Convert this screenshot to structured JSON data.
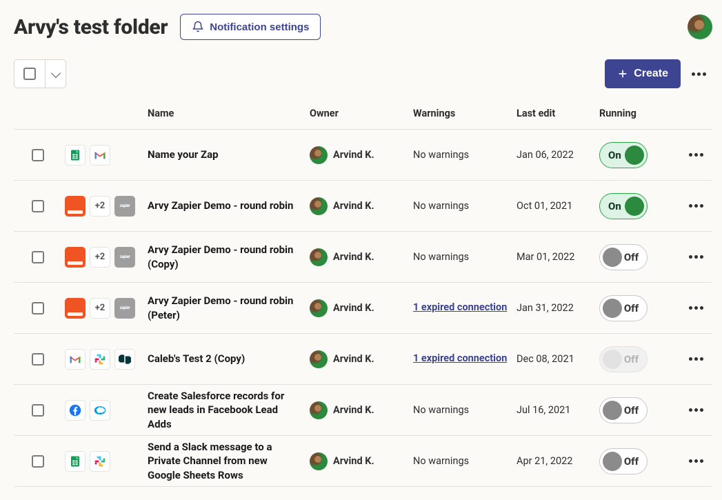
{
  "header": {
    "title": "Arvy's test folder",
    "notification_btn": "Notification settings"
  },
  "toolbar": {
    "create_label": "Create"
  },
  "columns": {
    "name": "Name",
    "owner": "Owner",
    "warnings": "Warnings",
    "last_edit": "Last edit",
    "running": "Running"
  },
  "toggle_labels": {
    "on": "On",
    "off": "Off"
  },
  "rows": [
    {
      "apps": [
        {
          "type": "sheets"
        },
        {
          "type": "gmail"
        }
      ],
      "name": "Name your Zap",
      "owner": "Arvind K.",
      "warning_text": "No warnings",
      "warning_link": null,
      "last_edit": "Jan 06, 2022",
      "running": "on"
    },
    {
      "apps": [
        {
          "type": "orange"
        },
        {
          "type": "more",
          "label": "+2"
        },
        {
          "type": "gray",
          "label": "zapier"
        }
      ],
      "name": "Arvy Zapier Demo - round robin",
      "owner": "Arvind K.",
      "warning_text": "No warnings",
      "warning_link": null,
      "last_edit": "Oct 01, 2021",
      "running": "on"
    },
    {
      "apps": [
        {
          "type": "orange"
        },
        {
          "type": "more",
          "label": "+2"
        },
        {
          "type": "gray",
          "label": "zapier"
        }
      ],
      "name": "Arvy Zapier Demo - round robin (Copy)",
      "owner": "Arvind K.",
      "warning_text": "No warnings",
      "warning_link": null,
      "last_edit": "Mar 01, 2022",
      "running": "off"
    },
    {
      "apps": [
        {
          "type": "orange"
        },
        {
          "type": "more",
          "label": "+2"
        },
        {
          "type": "gray",
          "label": "zapier"
        }
      ],
      "name": "Arvy Zapier Demo - round robin (Peter)",
      "owner": "Arvind K.",
      "warning_text": null,
      "warning_link": "1 expired connection",
      "last_edit": "Jan 31, 2022",
      "running": "off"
    },
    {
      "apps": [
        {
          "type": "gmail"
        },
        {
          "type": "slack"
        },
        {
          "type": "zendesk"
        }
      ],
      "name": "Caleb's Test 2 (Copy)",
      "owner": "Arvind K.",
      "warning_text": null,
      "warning_link": "1 expired connection",
      "last_edit": "Dec 08, 2021",
      "running": "disabled"
    },
    {
      "apps": [
        {
          "type": "facebook"
        },
        {
          "type": "salesforce"
        }
      ],
      "name": "Create Salesforce records for new leads in Facebook Lead Adds",
      "owner": "Arvind K.",
      "warning_text": "No warnings",
      "warning_link": null,
      "last_edit": "Jul 16, 2021",
      "running": "off"
    },
    {
      "apps": [
        {
          "type": "sheets"
        },
        {
          "type": "slack"
        }
      ],
      "name": "Send a Slack message to a Private Channel from new Google Sheets Rows",
      "owner": "Arvind K.",
      "warning_text": "No warnings",
      "warning_link": null,
      "last_edit": "Apr 21, 2022",
      "running": "off"
    }
  ]
}
